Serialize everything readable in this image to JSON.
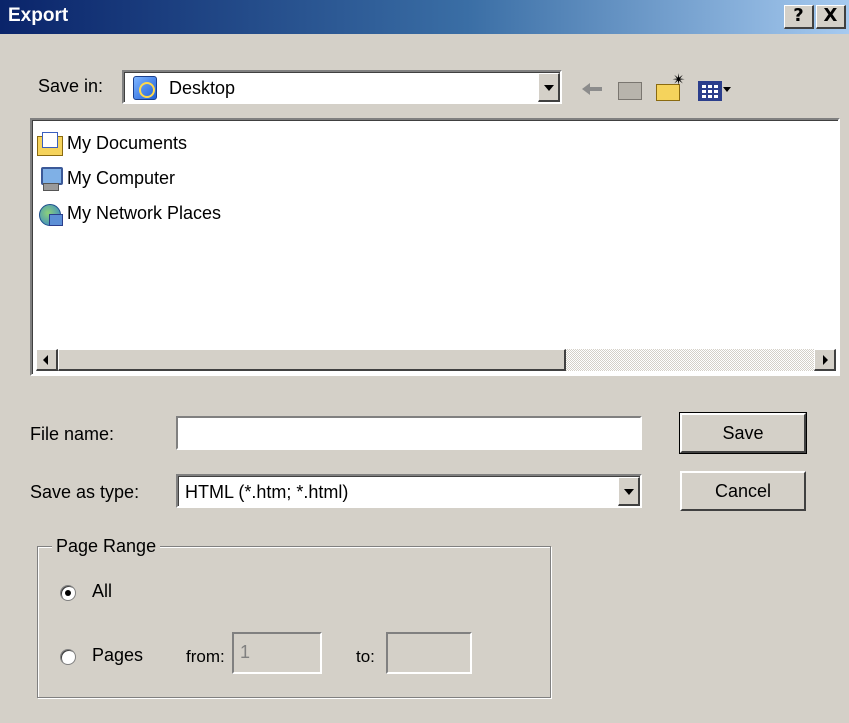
{
  "window": {
    "title": "Export",
    "help_label": "?",
    "close_label": "X"
  },
  "save_in": {
    "label": "Save in:",
    "value": "Desktop"
  },
  "file_list": {
    "items": [
      {
        "label": "My Documents",
        "icon": "my-documents-icon"
      },
      {
        "label": "My Computer",
        "icon": "my-computer-icon"
      },
      {
        "label": "My Network Places",
        "icon": "network-places-icon"
      }
    ]
  },
  "file_name": {
    "label": "File name:",
    "value": ""
  },
  "save_as_type": {
    "label": "Save as type:",
    "value": "HTML (*.htm; *.html)"
  },
  "buttons": {
    "save": "Save",
    "cancel": "Cancel"
  },
  "page_range": {
    "title": "Page Range",
    "all_label": "All",
    "pages_label": "Pages",
    "from_label": "from:",
    "from_value": "1",
    "to_label": "to:",
    "to_value": "",
    "selected": "All"
  }
}
